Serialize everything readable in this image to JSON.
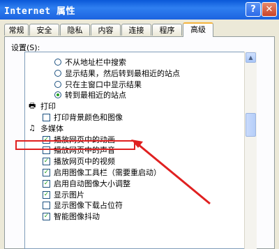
{
  "window": {
    "title": "Internet 属性",
    "help_label": "?",
    "close_label": "✕"
  },
  "tabs": [
    "常规",
    "安全",
    "隐私",
    "内容",
    "连接",
    "程序",
    "高级"
  ],
  "settings_label": "设置(S):",
  "items": [
    {
      "kind": "radio",
      "label": "不从地址栏中搜索",
      "checked": false
    },
    {
      "kind": "radio",
      "label": "显示结果，然后转到最相近的站点",
      "checked": false
    },
    {
      "kind": "radio",
      "label": "只在主窗口中显示结果",
      "checked": false
    },
    {
      "kind": "radio",
      "label": "转到最相近的站点",
      "checked": true
    },
    {
      "kind": "group",
      "label": "打印",
      "icon": "printer-icon"
    },
    {
      "kind": "checkbox",
      "label": "打印背景颜色和图像",
      "checked": false
    },
    {
      "kind": "group",
      "label": "多媒体",
      "icon": "multimedia-icon"
    },
    {
      "kind": "checkbox",
      "label": "播放网页中的动画",
      "checked": true
    },
    {
      "kind": "checkbox",
      "label": "播放网页中的声音",
      "checked": false
    },
    {
      "kind": "checkbox",
      "label": "播放网页中的视频",
      "checked": true
    },
    {
      "kind": "checkbox",
      "label": "启用图像工具栏（需要重启动）",
      "checked": true
    },
    {
      "kind": "checkbox",
      "label": "启用自动图像大小调整",
      "checked": true
    },
    {
      "kind": "checkbox",
      "label": "显示图片",
      "checked": true
    },
    {
      "kind": "checkbox",
      "label": "显示图像下载占位符",
      "checked": false
    },
    {
      "kind": "checkbox",
      "label": "智能图像抖动",
      "checked": true
    }
  ],
  "colors": {
    "title_bar": "#0a58d8",
    "highlight": "#e02020",
    "check": "#21a121"
  }
}
